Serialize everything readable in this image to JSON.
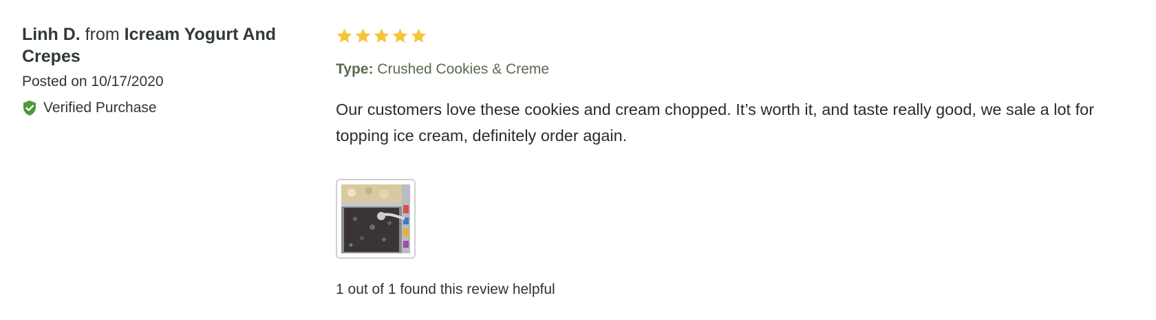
{
  "review": {
    "author_name": "Linh D.",
    "from_word": "from",
    "store_name": "Icream Yogurt And Crepes",
    "posted": "Posted on 10/17/2020",
    "verified_label": "Verified Purchase",
    "rating": 5,
    "rating_max": 5,
    "type_label": "Type:",
    "type_value": "Crushed Cookies & Creme",
    "body": "Our customers love these cookies and cream chopped. It’s worth it, and taste really good, we sale a lot for topping ice cream, definitely order again.",
    "helpful_text": "1 out of 1 found this review helpful"
  },
  "colors": {
    "star": "#F7C53A",
    "verified_shield": "#4E9A3A",
    "type_text": "#5A6A50",
    "thumb_border": "#CFCFCF"
  },
  "icons": {
    "verified": "shield-check-icon",
    "rating": "star-icon"
  }
}
